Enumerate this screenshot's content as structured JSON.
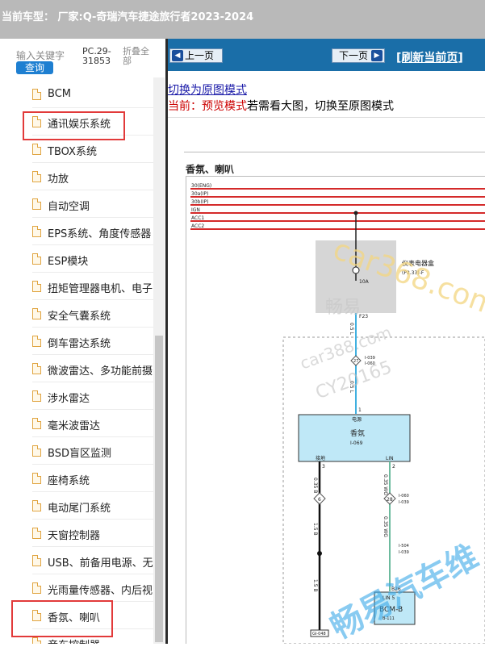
{
  "header": {
    "title": "当前车型：  厂家:Q-奇瑞汽车捷途旅行者2023-2024"
  },
  "search": {
    "label": "输入关键字",
    "button": "查询",
    "model_code": "PC.29-31853",
    "collapse_all": "折叠全部"
  },
  "tree": {
    "items": [
      "BCM",
      "通讯娱乐系统",
      "TBOX系统",
      "功放",
      "自动空调",
      "EPS系统、角度传感器",
      "ESP模块",
      "扭矩管理器电机、电子",
      "安全气囊系统",
      "倒车雷达系统",
      "微波雷达、多功能前摄",
      "涉水雷达",
      "毫米波雷达",
      "BSD盲区监测",
      "座椅系统",
      "电动尾门系统",
      "天窗控制器",
      "USB、前备用电源、无",
      "光雨量传感器、内后视",
      "香氛、喇叭",
      "音东控制器"
    ]
  },
  "nav": {
    "prev": "上一页",
    "next": "下一页",
    "refresh": "[刷新当前页]"
  },
  "content": {
    "switch_link": "切换为原图模式",
    "hint_prefix": "当前：预览模式",
    "hint_suffix": "若需看大图，切换至原图模式"
  },
  "diagram": {
    "title": "香氛、喇叭",
    "rails": [
      "30(ENG)",
      "30a(IP)",
      "30b(IP)",
      "IGN",
      "ACC1",
      "ACC2"
    ],
    "fuse_box": "仪表电器盒",
    "fuse_box_code": "(P2.33)-F",
    "fuse_rating": "10A",
    "fuse_code": "F23",
    "wire_blue": "0.5 L",
    "connector_27": "27",
    "conn_tag_1": "I-039",
    "conn_tag_2": "I-060",
    "pin_1": "1",
    "module_power": "电源",
    "module_name": "香氛",
    "module_code": "I-069",
    "module_ground": "接地",
    "module_lin": "LIN",
    "pin_3": "3",
    "pin_2": "2",
    "wire_black_1": "0.35 B",
    "wire_wg_1": "0.35 WG",
    "splice_6": "6",
    "splice_28": "28",
    "tag_i060": "I-060",
    "tag_i039": "I-039",
    "wire_black_2": "1.5 B",
    "wire_wg_2": "0.35 WG",
    "tag_i504": "I-504",
    "tag_i039b": "I-039",
    "wire_black_3": "1.5 B",
    "pin_b26": "B26",
    "bcm_lin": "LIN 5",
    "bcm_name": "BCM-B",
    "bcm_code": "B-111",
    "ground_code": "GI-048",
    "watermarks": [
      "car368.com",
      "畅易",
      "car388.com",
      "CY20165",
      "畅易汽车维"
    ]
  },
  "colors": {
    "highlight": "#e23a3a",
    "navbar": "#1a6ea8",
    "rail_red": "#d42a2a",
    "wire_blue": "#40b0e0",
    "module_fill": "#bfe8f7"
  }
}
